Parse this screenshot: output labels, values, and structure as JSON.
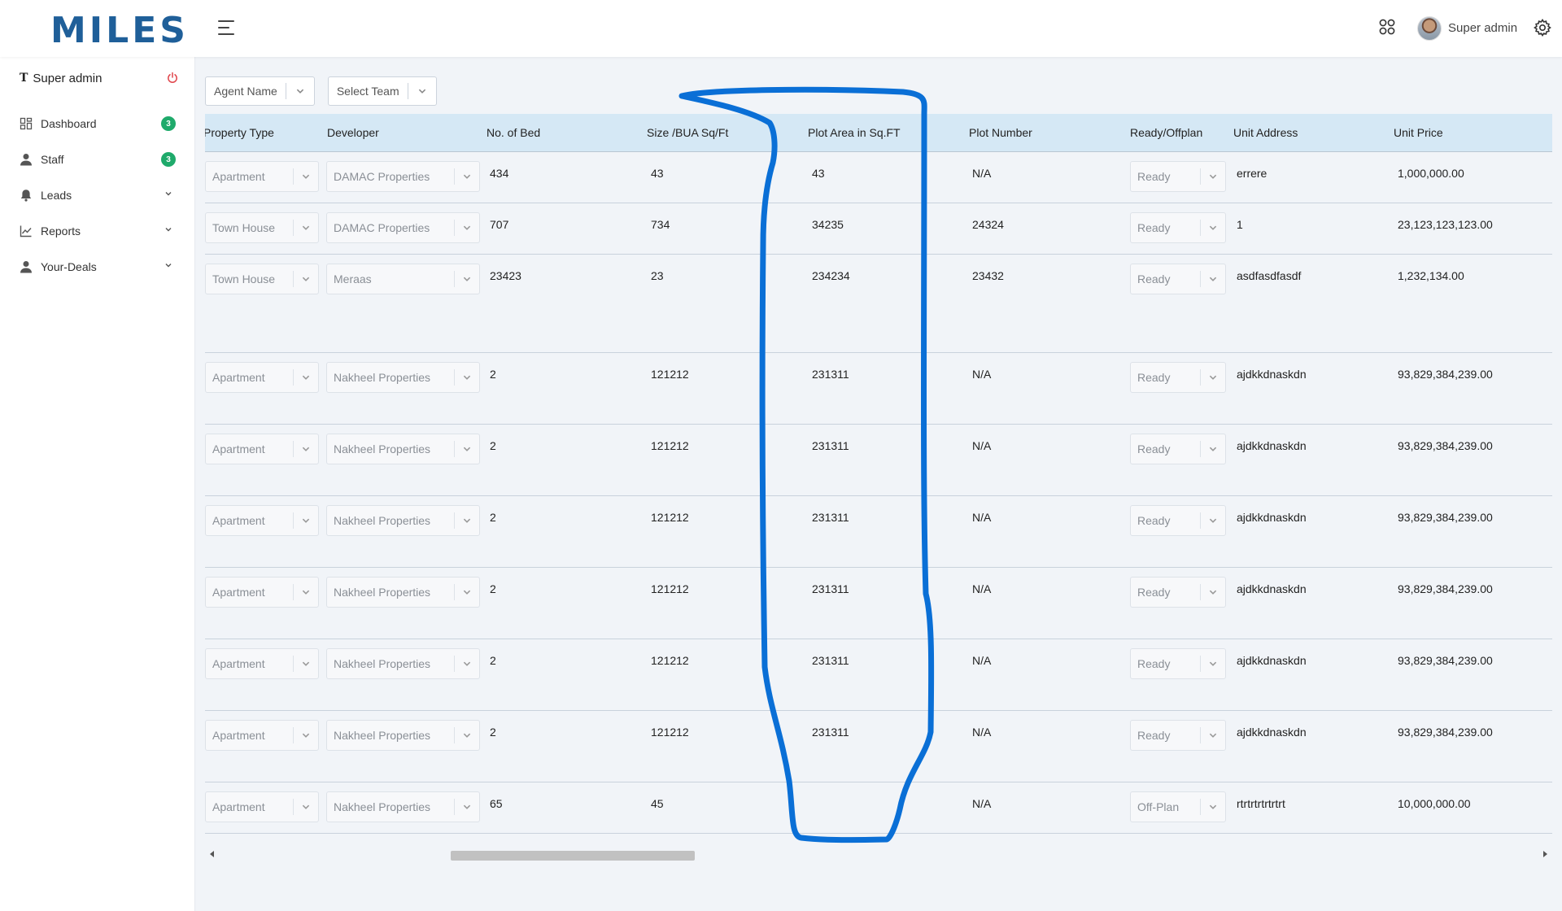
{
  "app": {
    "logo": "MILES",
    "user_name": "Super admin"
  },
  "sidebar": {
    "user_label": "Super admin",
    "items": [
      {
        "label": "Dashboard",
        "icon": "dashboard-icon",
        "badge": "3"
      },
      {
        "label": "Staff",
        "icon": "person-icon",
        "badge": "3"
      },
      {
        "label": "Leads",
        "icon": "bell-icon",
        "expandable": true
      },
      {
        "label": "Reports",
        "icon": "chart-line-icon",
        "expandable": true
      },
      {
        "label": "Your-Deals",
        "icon": "person-icon",
        "expandable": true
      }
    ]
  },
  "filters": {
    "agent_name": "Agent Name",
    "select_team": "Select Team"
  },
  "table": {
    "headers": [
      "Property Type",
      "Developer",
      "No. of Bed",
      "Size /BUA Sq/Ft",
      "Plot Area in Sq.FT",
      "Plot Number",
      "Ready/Offplan",
      "Unit Address",
      "Unit Price"
    ],
    "rows": [
      {
        "property_type": "Apartment",
        "developer": "DAMAC Properties",
        "beds": "434",
        "size": "43",
        "plot_area": "43",
        "plot_number": "N/A",
        "status": "Ready",
        "address": "errere",
        "price": "1,000,000.00"
      },
      {
        "property_type": "Town House",
        "developer": "DAMAC Properties",
        "beds": "707",
        "size": "734",
        "plot_area": "34235",
        "plot_number": "24324",
        "status": "Ready",
        "address": "1",
        "price": "23,123,123,123.00"
      },
      {
        "property_type": "Town House",
        "developer": "Meraas",
        "beds": "23423",
        "size": "23",
        "plot_area": "234234",
        "plot_number": "23432",
        "status": "Ready",
        "address": "asdfasdfasdf",
        "price": "1,232,134.00"
      },
      {
        "property_type": "Apartment",
        "developer": "Nakheel Properties",
        "beds": "2",
        "size": "121212",
        "plot_area": "231311",
        "plot_number": "N/A",
        "status": "Ready",
        "address": "ajdkkdnaskdn",
        "price": "93,829,384,239.00"
      },
      {
        "property_type": "Apartment",
        "developer": "Nakheel Properties",
        "beds": "2",
        "size": "121212",
        "plot_area": "231311",
        "plot_number": "N/A",
        "status": "Ready",
        "address": "ajdkkdnaskdn",
        "price": "93,829,384,239.00"
      },
      {
        "property_type": "Apartment",
        "developer": "Nakheel Properties",
        "beds": "2",
        "size": "121212",
        "plot_area": "231311",
        "plot_number": "N/A",
        "status": "Ready",
        "address": "ajdkkdnaskdn",
        "price": "93,829,384,239.00"
      },
      {
        "property_type": "Apartment",
        "developer": "Nakheel Properties",
        "beds": "2",
        "size": "121212",
        "plot_area": "231311",
        "plot_number": "N/A",
        "status": "Ready",
        "address": "ajdkkdnaskdn",
        "price": "93,829,384,239.00"
      },
      {
        "property_type": "Apartment",
        "developer": "Nakheel Properties",
        "beds": "2",
        "size": "121212",
        "plot_area": "231311",
        "plot_number": "N/A",
        "status": "Ready",
        "address": "ajdkkdnaskdn",
        "price": "93,829,384,239.00"
      },
      {
        "property_type": "Apartment",
        "developer": "Nakheel Properties",
        "beds": "2",
        "size": "121212",
        "plot_area": "231311",
        "plot_number": "N/A",
        "status": "Ready",
        "address": "ajdkkdnaskdn",
        "price": "93,829,384,239.00"
      },
      {
        "property_type": "Apartment",
        "developer": "Nakheel Properties",
        "beds": "65",
        "size": "45",
        "plot_area": "",
        "plot_number": "N/A",
        "status": "Off-Plan",
        "address": "rtrtrtrtrtrtrt",
        "price": "10,000,000.00"
      }
    ]
  },
  "colors": {
    "brand": "#1f5f99",
    "header_bg": "#d5e8f5",
    "badge": "#1faa6b",
    "annotation": "#0a6fd6",
    "power": "#e0454b"
  }
}
